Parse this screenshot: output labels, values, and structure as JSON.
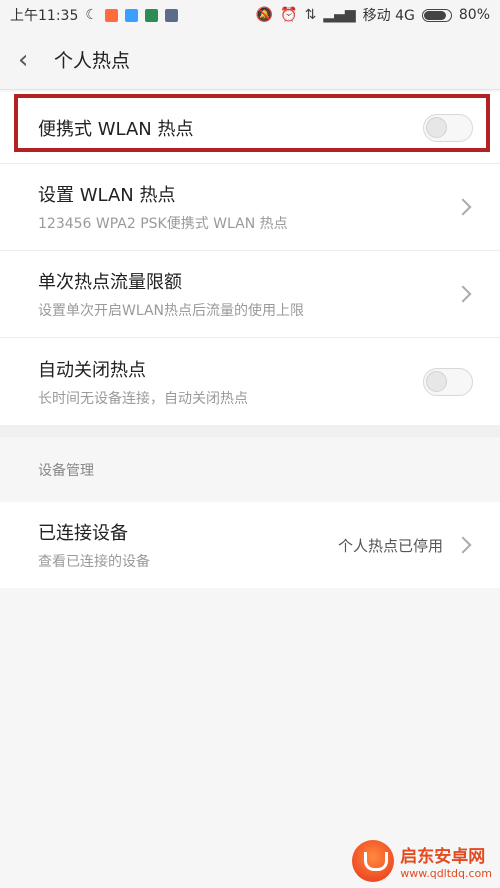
{
  "status_bar": {
    "time": "上午11:35",
    "carrier": "移动 4G",
    "battery": "80%",
    "battery_level": 0.8,
    "app_icon_colors": [
      "#ff6b3d",
      "#3aa0ff",
      "#2e8b57",
      "#5b6b8c"
    ],
    "icons": [
      "mute-icon",
      "alarm-icon",
      "data-icon",
      "signal-icon"
    ]
  },
  "header": {
    "back_icon": "chevron-left-icon",
    "title": "个人热点"
  },
  "hotspot_group": {
    "portable_wlan": {
      "label": "便携式 WLAN 热点",
      "enabled": false
    },
    "setup_wlan": {
      "label": "设置 WLAN 热点",
      "sub": "123456 WPA2 PSK便携式 WLAN 热点"
    },
    "data_limit": {
      "label": "单次热点流量限额",
      "sub": "设置单次开启WLAN热点后流量的使用上限"
    },
    "auto_close": {
      "label": "自动关闭热点",
      "sub": "长时间无设备连接，自动关闭热点",
      "enabled": false
    }
  },
  "device_management": {
    "section_title": "设备管理",
    "connected": {
      "label": "已连接设备",
      "sub": "查看已连接的设备",
      "value": "个人热点已停用"
    }
  },
  "watermark": {
    "name": "启东安卓网",
    "url": "www.qdltdq.com"
  },
  "colors": {
    "highlight_border": "#b22222",
    "watermark": "#e34a1f"
  }
}
